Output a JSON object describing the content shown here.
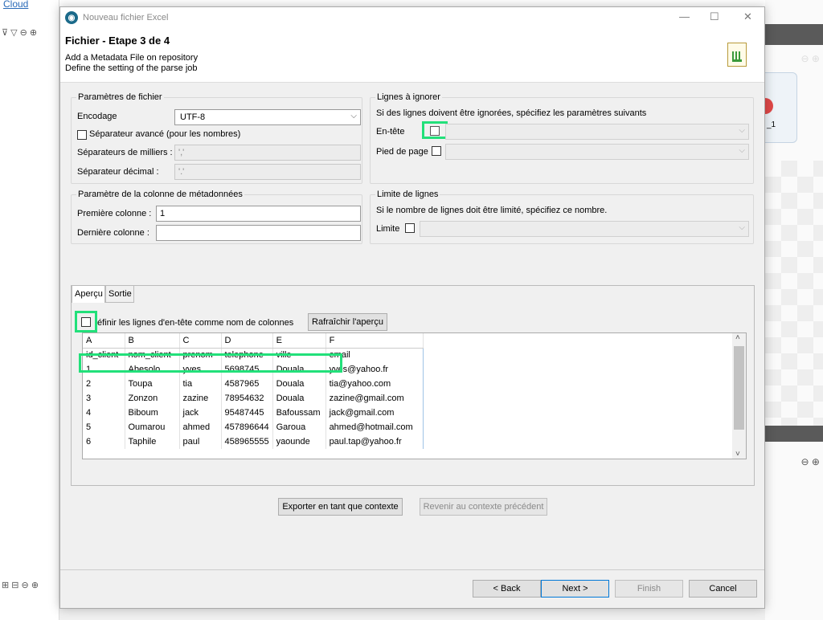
{
  "background": {
    "cloud_link": "Cloud",
    "right_card_label": "_1"
  },
  "dialog": {
    "window_title": "Nouveau fichier Excel",
    "header_title": "Fichier - Etape 3 de 4",
    "header_line1": "Add a Metadata File on repository",
    "header_line2": "Define the setting of the parse job"
  },
  "file_params": {
    "title": "Paramètres de fichier",
    "encoding_label": "Encodage",
    "encoding_value": "UTF-8",
    "advanced_sep_label": "Séparateur avancé (pour les nombres)",
    "thousands_label": "Séparateurs de milliers :",
    "thousands_value": "','",
    "decimal_label": "Séparateur décimal :",
    "decimal_value": "'.'"
  },
  "skip_lines": {
    "title": "Lignes à ignorer",
    "hint": "Si des lignes doivent être ignorées, spécifiez les paramètres suivants",
    "header_label": "En-tête",
    "footer_label": "Pied de page"
  },
  "metadata_cols": {
    "title": "Paramètre de la colonne de métadonnées",
    "first_label": "Première colonne :",
    "first_value": "1",
    "last_label": "Dernière colonne :",
    "last_value": ""
  },
  "row_limit": {
    "title": "Limite de lignes",
    "hint": "Si le nombre de lignes doit être limité, spécifiez ce nombre.",
    "limit_label": "Limite"
  },
  "preview": {
    "tab_preview": "Aperçu",
    "tab_output": "Sortie",
    "define_header_label": "éfinir les lignes d'en-tête comme nom de colonnes",
    "refresh_button": "Rafraîchir l'aperçu",
    "columns": [
      "A",
      "B",
      "C",
      "D",
      "E",
      "F"
    ],
    "rows": [
      [
        "id_client",
        "nom_client",
        "prenom",
        "telephone",
        "ville",
        "email"
      ],
      [
        "1",
        "Abesolo",
        "yves",
        "5698745",
        "Douala",
        "yves@yahoo.fr"
      ],
      [
        "2",
        "Toupa",
        "tia",
        "4587965",
        "Douala",
        "tia@yahoo.com"
      ],
      [
        "3",
        "Zonzon",
        "zazine",
        "78954632",
        "Douala",
        "zazine@gmail.com"
      ],
      [
        "4",
        "Biboum",
        "jack",
        "95487445",
        "Bafoussam",
        "jack@gmail.com"
      ],
      [
        "5",
        "Oumarou",
        "ahmed",
        "457896644",
        "Garoua",
        "ahmed@hotmail.com"
      ],
      [
        "6",
        "Taphile",
        "paul",
        "458965555",
        "yaounde",
        "paul.tap@yahoo.fr"
      ]
    ]
  },
  "context_buttons": {
    "export": "Exporter en tant que contexte",
    "revert": "Revenir au contexte précédent"
  },
  "nav_buttons": {
    "back": "< Back",
    "next": "Next >",
    "finish": "Finish",
    "cancel": "Cancel"
  }
}
